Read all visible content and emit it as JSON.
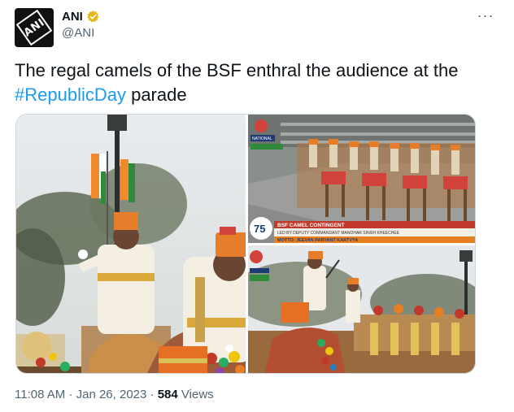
{
  "author": {
    "display_name": "ANI",
    "handle": "@ANI",
    "avatar_text": "ANI",
    "verified_icon": "verified-badge-icon"
  },
  "menu": {
    "more_label": "···"
  },
  "tweet": {
    "text_before": "The regal camels of the BSF enthral the audience at the ",
    "hashtag": "#RepublicDay",
    "text_after": " parade"
  },
  "media": {
    "broadcast": {
      "channel_label": "NATIONAL",
      "logo_number": "75",
      "banner_title": "BSF CAMEL CONTINGENT",
      "banner_line2": "LED BY DEPUTY COMMANDANT MANOHAR SINGH KHEECHEE",
      "banner_line3": "MOTTO: JEEVAN PARYANT KARTVYA"
    }
  },
  "footer": {
    "time": "11:08 AM",
    "separator": "·",
    "date": "Jan 26, 2023",
    "views_count": "584",
    "views_label": "Views"
  },
  "colors": {
    "link_blue": "#1d9bf0",
    "verified_gold": "#e2b719",
    "muted_text": "#536471",
    "primary_text": "#0f1419"
  }
}
